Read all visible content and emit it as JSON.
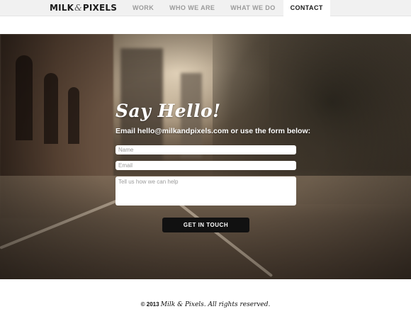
{
  "brand": {
    "name_part1": "MILK",
    "name_amp": "&",
    "name_part2": "PIXELS"
  },
  "nav": {
    "items": [
      {
        "label": "WORK",
        "active": false
      },
      {
        "label": "WHO WE ARE",
        "active": false
      },
      {
        "label": "WHAT WE DO",
        "active": false
      },
      {
        "label": "CONTACT",
        "active": true
      }
    ]
  },
  "contact": {
    "headline": "Say Hello!",
    "subline": "Email hello@milkandpixels.com or use the form below:",
    "name_placeholder": "Name",
    "email_placeholder": "Email",
    "message_placeholder": "Tell us how we can help",
    "submit_label": "GET IN TOUCH"
  },
  "footer": {
    "copyright_prefix": "© 2013",
    "copyright_text": "Milk & Pixels. All rights reserved."
  },
  "colors": {
    "topbar_bg": "#f1f1f1",
    "nav_inactive": "#9a9a9a",
    "nav_active": "#1a1a1a",
    "button_bg": "#111111"
  }
}
